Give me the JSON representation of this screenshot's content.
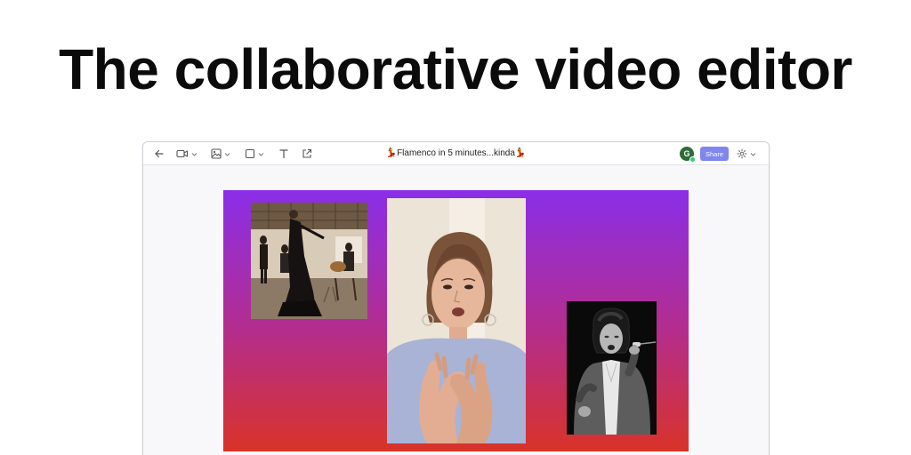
{
  "hero": {
    "title": "The collaborative video editor"
  },
  "toolbar": {
    "icons": [
      "back-arrow-icon",
      "video-camera-icon",
      "image-icon",
      "shape-square-icon",
      "text-icon",
      "export-icon",
      "gear-icon"
    ],
    "document_title": "💃Flamenco in 5 minutes...kinda💃",
    "avatar_initial": "G",
    "share_label": "Share"
  },
  "canvas": {
    "gradient": [
      "#8a2ee8",
      "#b52d8a",
      "#d83328"
    ],
    "clips": [
      "flamenco-dancer-clip",
      "presenter-video-clip",
      "singer-photo-clip"
    ]
  },
  "colors": {
    "accent": "#7f86ee",
    "avatar": "#2e6b3a",
    "status_online": "#2ecc71"
  }
}
